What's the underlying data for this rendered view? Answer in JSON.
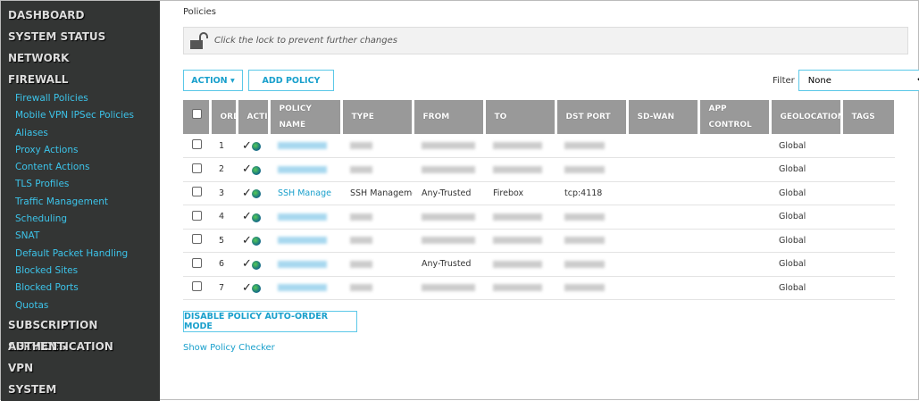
{
  "sidebar": {
    "top1": [
      "DASHBOARD",
      "SYSTEM STATUS",
      "NETWORK",
      "FIREWALL"
    ],
    "firewall_items": [
      "Firewall Policies",
      "Mobile VPN IPSec Policies",
      "Aliases",
      "Proxy Actions",
      "Content Actions",
      "TLS Profiles",
      "Traffic Management",
      "Scheduling",
      "SNAT",
      "Default Packet Handling",
      "Blocked Sites",
      "Blocked Ports",
      "Quotas"
    ],
    "top2": [
      "SUBSCRIPTION SERVICES",
      "AUTHENTICATION",
      "VPN",
      "SYSTEM"
    ]
  },
  "breadcrumb": "Policies",
  "lock_message": "Click the lock to prevent further changes",
  "toolbar": {
    "action": "ACTION ▾",
    "add_policy": "ADD POLICY",
    "filter_label": "Filter",
    "filter_value": "None"
  },
  "table": {
    "headers": [
      "",
      "ORDER",
      "ACTION",
      "POLICY NAME",
      "TYPE",
      "FROM",
      "TO",
      "DST PORT",
      "SD-WAN",
      "APP CONTROL",
      "GEOLOCATION",
      "TAGS"
    ],
    "rows": [
      {
        "order": "1",
        "name": "",
        "type": "",
        "from": "",
        "to": "",
        "port": "",
        "geo": "Global"
      },
      {
        "order": "2",
        "name": "",
        "type": "",
        "from": "",
        "to": "",
        "port": "",
        "geo": "Global"
      },
      {
        "order": "3",
        "name": "SSH Manage",
        "type": "SSH Manageme",
        "from": "Any-Trusted",
        "to": "Firebox",
        "port": "tcp:4118",
        "geo": "Global"
      },
      {
        "order": "4",
        "name": "",
        "type": "",
        "from": "",
        "to": "",
        "port": "",
        "geo": "Global"
      },
      {
        "order": "5",
        "name": "",
        "type": "",
        "from": "",
        "to": "",
        "port": "",
        "geo": "Global"
      },
      {
        "order": "6",
        "name": "",
        "type": "",
        "from": "Any-Trusted",
        "to": "",
        "port": "",
        "geo": "Global"
      },
      {
        "order": "7",
        "name": "",
        "type": "",
        "from": "",
        "to": "",
        "port": "",
        "geo": "Global"
      }
    ]
  },
  "disable_button": "DISABLE POLICY AUTO-ORDER MODE",
  "show_checker": "Show Policy Checker"
}
